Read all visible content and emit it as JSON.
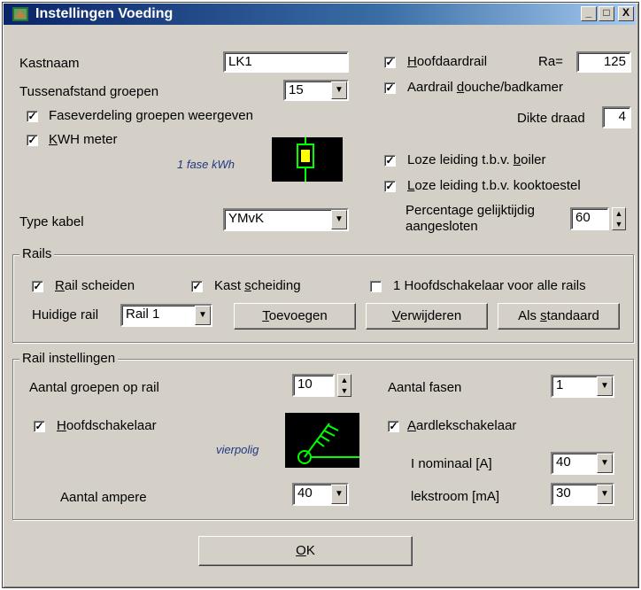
{
  "window": {
    "title": "Instellingen Voeding",
    "buttons": [
      "_",
      "□",
      "X"
    ]
  },
  "general": {
    "kastnaam_label": "Kastnaam",
    "kastnaam_value": "LK1",
    "tussenafstand_label": "Tussenafstand groepen",
    "tussenafstand_value": "15",
    "faseverdeling_label": "Faseverdeling groepen weergeven",
    "kwh_label_pre": "",
    "kwh_label_u": "K",
    "kwh_label_post": "WH meter",
    "kwh_note": "1 fase kWh",
    "type_kabel_label": "Type kabel",
    "type_kabel_value": "YMvK",
    "hoofdaardrail_u": "H",
    "hoofdaardrail_post": "oofdaardrail",
    "ra_label": "Ra=",
    "ra_value": "125",
    "aardrail_pre": "Aardrail ",
    "aardrail_u": "d",
    "aardrail_post": "ouche/badkamer",
    "dikte_label": "Dikte draad",
    "dikte_value": "4",
    "boiler_pre": "Loze leiding t.b.v. ",
    "boiler_u": "b",
    "boiler_post": "oiler",
    "kook_pre": "",
    "kook_u": "L",
    "kook_post": "oze leiding t.b.v. kooktoestel",
    "percentage_label_1": "Percentage gelijktijdig",
    "percentage_label_2": "aangesloten",
    "percentage_value": "60"
  },
  "rails": {
    "title": "Rails",
    "rail_scheiden_u": "R",
    "rail_scheiden_post": "ail scheiden",
    "kast_pre": "Kast ",
    "kast_u": "s",
    "kast_post": "cheiding",
    "hoofdschakelaar_all": "1 Hoofdschakelaar voor alle rails",
    "huidige_label": "Huidige rail",
    "huidige_value": "Rail 1",
    "toevoegen_u": "T",
    "toevoegen_post": "oevoegen",
    "verwijderen_u": "V",
    "verwijderen_post": "erwijderen",
    "standaard_pre": "Als ",
    "standaard_u": "s",
    "standaard_post": "tandaard"
  },
  "rail_settings": {
    "title": "Rail instellingen",
    "groepen_label": "Aantal groepen op rail",
    "groepen_value": "10",
    "fasen_label": "Aantal fasen",
    "fasen_value": "1",
    "hoofd_u": "H",
    "hoofd_post": "oofdschakelaar",
    "hoofd_note": "vierpolig",
    "aardlek_u": "A",
    "aardlek_post": "ardlekschakelaar",
    "inominaal_label": "I nominaal [A]",
    "inominaal_value": "40",
    "lekstroom_label": "lekstroom [mA]",
    "lekstroom_value": "30",
    "ampere_label": "Aantal ampere",
    "ampere_value": "40"
  },
  "ok": {
    "u": "O",
    "post": "K"
  },
  "colors": {
    "titlebar": "#0a246a",
    "face": "#d4d0c8",
    "symbol": "#00ff00",
    "meter": "#ffff00"
  }
}
